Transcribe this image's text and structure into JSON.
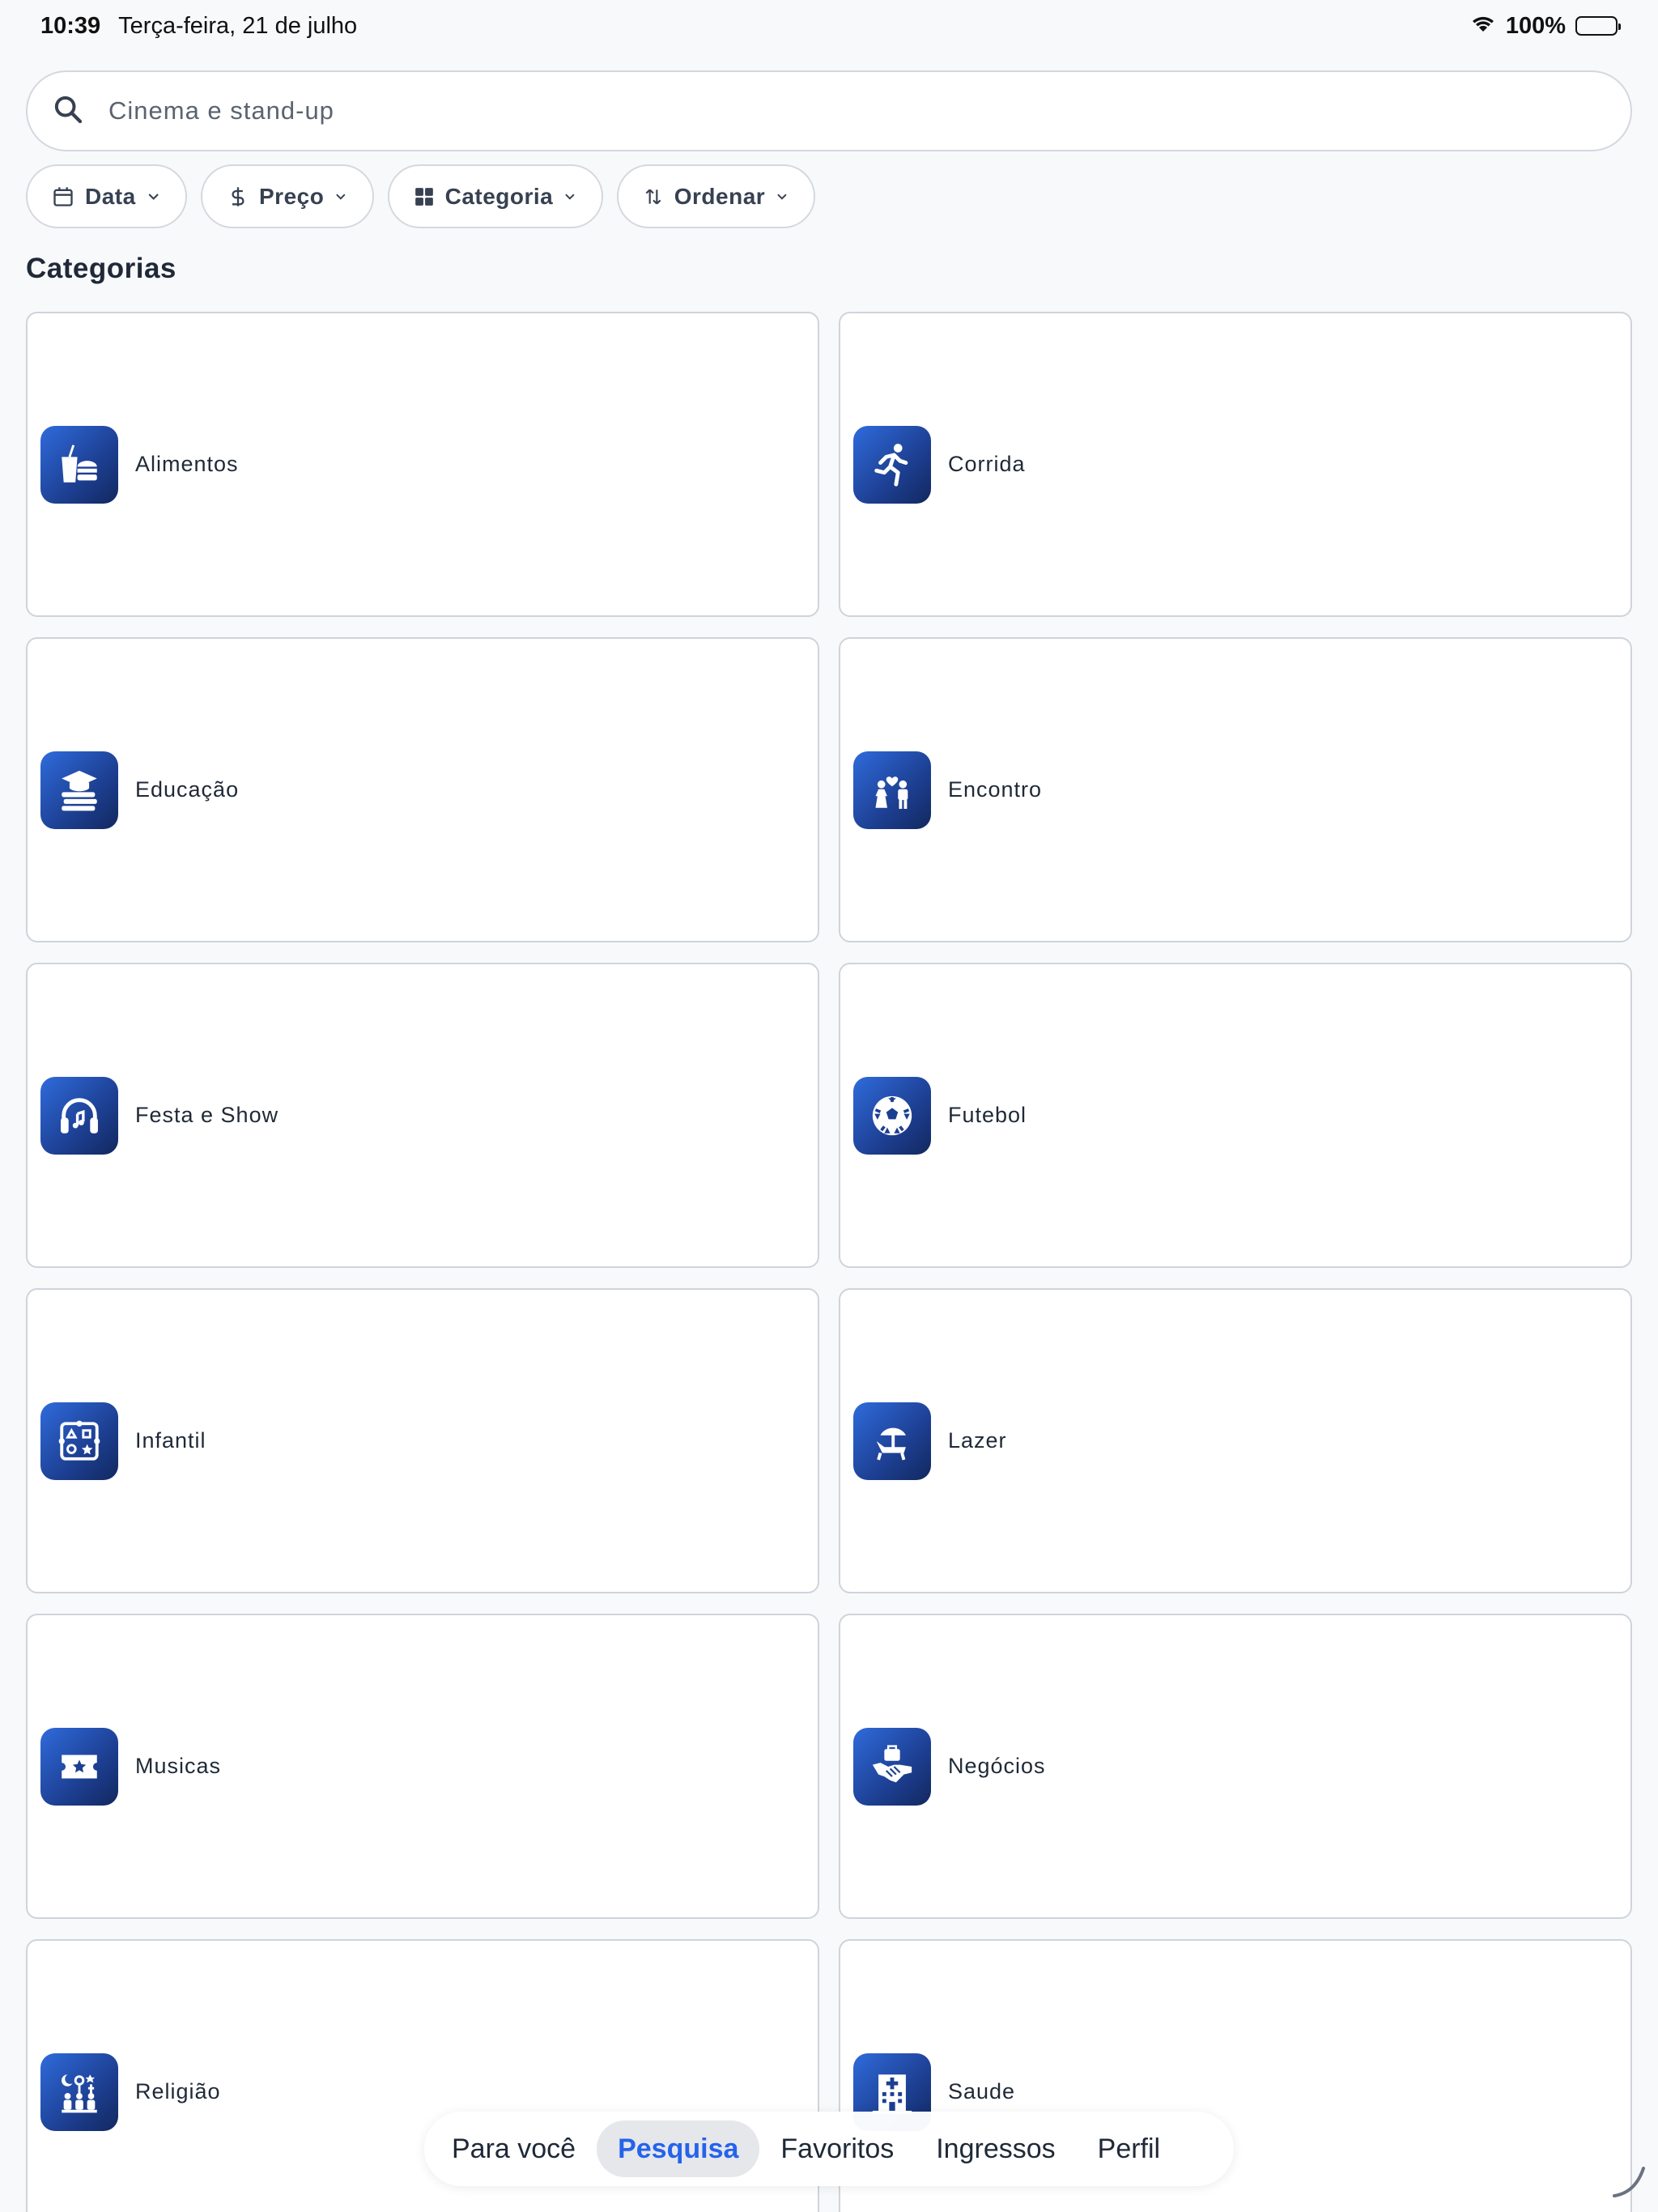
{
  "status_bar": {
    "time": "10:39",
    "date": "Terça-feira, 21 de julho",
    "battery": "100%"
  },
  "search": {
    "placeholder": "Cinema e stand-up"
  },
  "filters": [
    {
      "label": "Data",
      "icon": "calendar-icon"
    },
    {
      "label": "Preço",
      "icon": "dollar-icon"
    },
    {
      "label": "Categoria",
      "icon": "grid-icon"
    },
    {
      "label": "Ordenar",
      "icon": "sort-icon"
    }
  ],
  "section_title": "Categorias",
  "categories": [
    {
      "label": "Alimentos",
      "icon": "food-icon"
    },
    {
      "label": "Corrida",
      "icon": "running-icon"
    },
    {
      "label": "Educação",
      "icon": "education-icon"
    },
    {
      "label": "Encontro",
      "icon": "couple-icon"
    },
    {
      "label": "Festa e Show",
      "icon": "headphones-icon"
    },
    {
      "label": "Futebol",
      "icon": "soccer-ball-icon"
    },
    {
      "label": "Infantil",
      "icon": "puzzle-icon"
    },
    {
      "label": "Lazer",
      "icon": "beach-chair-icon"
    },
    {
      "label": "Musicas",
      "icon": "ticket-star-icon"
    },
    {
      "label": "Negócios",
      "icon": "handshake-icon"
    },
    {
      "label": "Religião",
      "icon": "religion-icon"
    },
    {
      "label": "Saude",
      "icon": "hospital-icon"
    }
  ],
  "tabs": [
    {
      "label": "Para você",
      "active": false
    },
    {
      "label": "Pesquisa",
      "active": true
    },
    {
      "label": "Favoritos",
      "active": false
    },
    {
      "label": "Ingressos",
      "active": false
    },
    {
      "label": "Perfil",
      "active": false
    }
  ],
  "colors": {
    "accent": "#2563eb",
    "icon_gradient_start": "#2f6bdc",
    "icon_gradient_end": "#12285f"
  }
}
